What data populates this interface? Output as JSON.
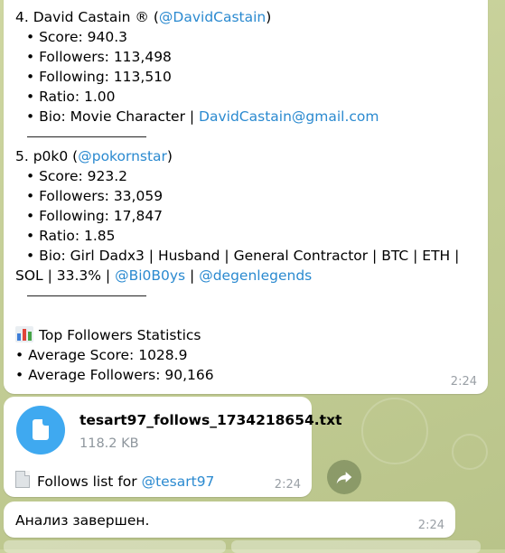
{
  "results": {
    "entry4": {
      "title_prefix": "4. David Castain ® (",
      "handle": "@DavidCastain",
      "title_suffix": ")",
      "score": "• Score: 940.3",
      "followers": "• Followers: 113,498",
      "following": "• Following: 113,510",
      "ratio": "• Ratio: 1.00",
      "bio_prefix": "• Bio: Movie Character | ",
      "bio_email": "DavidCastain@gmail.com"
    },
    "entry5": {
      "title_prefix": "5. p0k0 (",
      "handle": "@pokornstar",
      "title_suffix": ")",
      "score": "• Score: 923.2",
      "followers": "• Followers: 33,059",
      "following": "• Following: 17,847",
      "ratio": "• Ratio: 1.85",
      "bio_line1": "• Bio: Girl Dadx3 | Husband | General Contractor | BTC | ETH |",
      "bio_line2_prefix": "SOL | 33.3% | ",
      "bio_handle1": "@Bi0B0ys",
      "bio_sep": " | ",
      "bio_handle2": "@degenlegends"
    },
    "stats": {
      "title": "Top Followers Statistics",
      "avg_score": "• Average Score: 1028.9",
      "avg_followers": "• Average Followers: 90,166"
    },
    "time": "2:24"
  },
  "file_message": {
    "file_name": "tesart97_follows_1734218654.txt",
    "file_size": "118.2 KB",
    "caption_prefix": "Follows list for ",
    "caption_handle": "@tesart97",
    "time": "2:24"
  },
  "done_message": {
    "text": "Анализ завершен.",
    "time": "2:24"
  },
  "colors": {
    "link": "#2b8ad0",
    "file_icon": "#3fa9f0",
    "chat_background": "#c9d29c"
  }
}
